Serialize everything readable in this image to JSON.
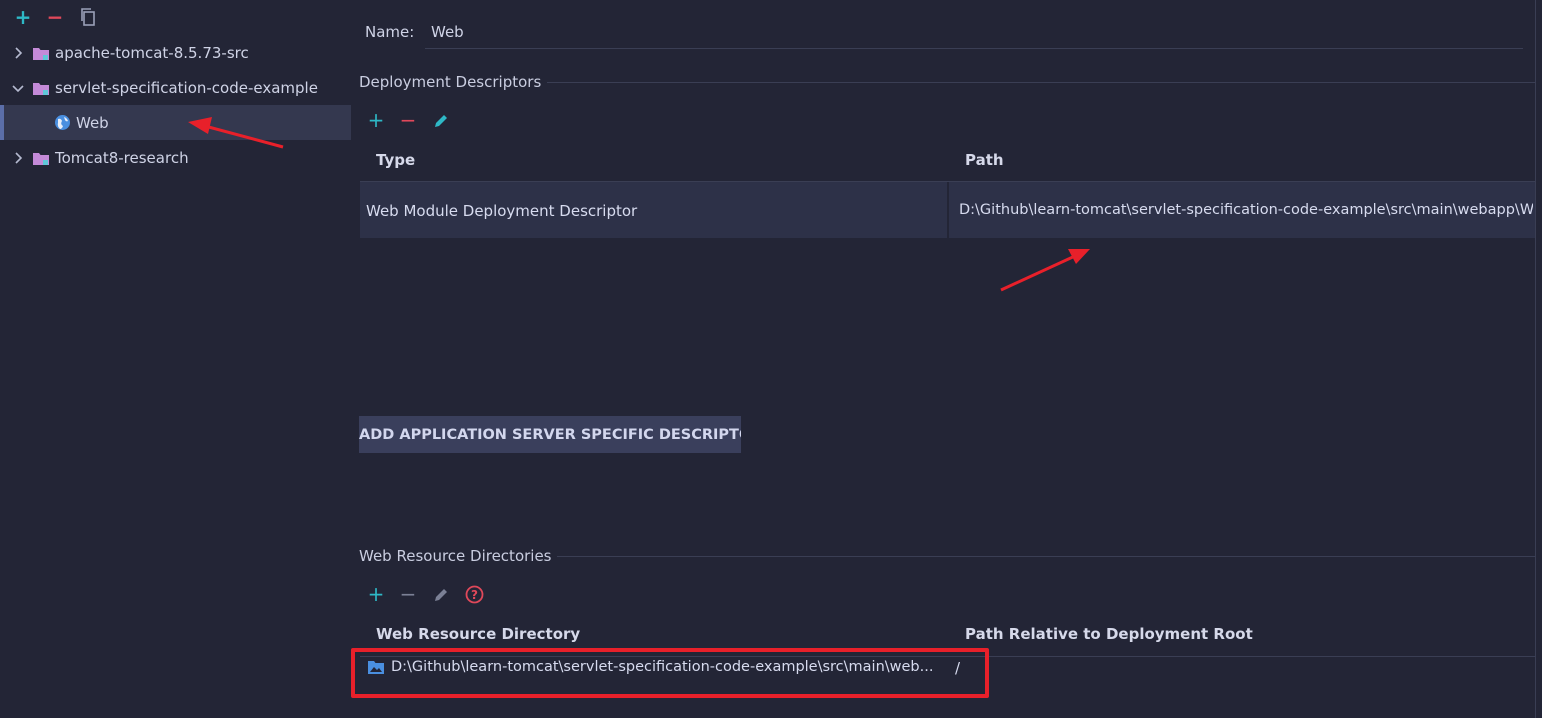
{
  "toolbar": {
    "add_icon": "plus-icon",
    "remove_icon": "minus-icon",
    "copy_icon": "copy-icon"
  },
  "tree": {
    "items": [
      {
        "label": "apache-tomcat-8.5.73-src",
        "expanded": false
      },
      {
        "label": "servlet-specification-code-example",
        "expanded": true
      },
      {
        "label": "Web",
        "selected": true
      },
      {
        "label": "Tomcat8-research",
        "expanded": false
      }
    ]
  },
  "name_field": {
    "label": "Name:",
    "value": "Web"
  },
  "deployment_descriptors": {
    "title": "Deployment Descriptors",
    "columns": [
      "Type",
      "Path"
    ],
    "rows": [
      {
        "type": "Web Module Deployment Descriptor",
        "path": "D:\\Github\\learn-tomcat\\servlet-specification-code-example\\src\\main\\webapp\\W"
      }
    ],
    "add_button": "ADD APPLICATION SERVER SPECIFIC DESCRIPTOR..."
  },
  "web_resources": {
    "title": "Web Resource Directories",
    "columns": [
      "Web Resource Directory",
      "Path Relative to Deployment Root"
    ],
    "rows": [
      {
        "directory": "D:\\Github\\learn-tomcat\\servlet-specification-code-example\\src\\main\\web...",
        "relative": "/"
      }
    ]
  },
  "colors": {
    "background": "#232536",
    "selected_row": "#34384f",
    "accent_add": "#2eb8c6",
    "accent_remove": "#e0485a",
    "annotation_red": "#e8202a"
  }
}
